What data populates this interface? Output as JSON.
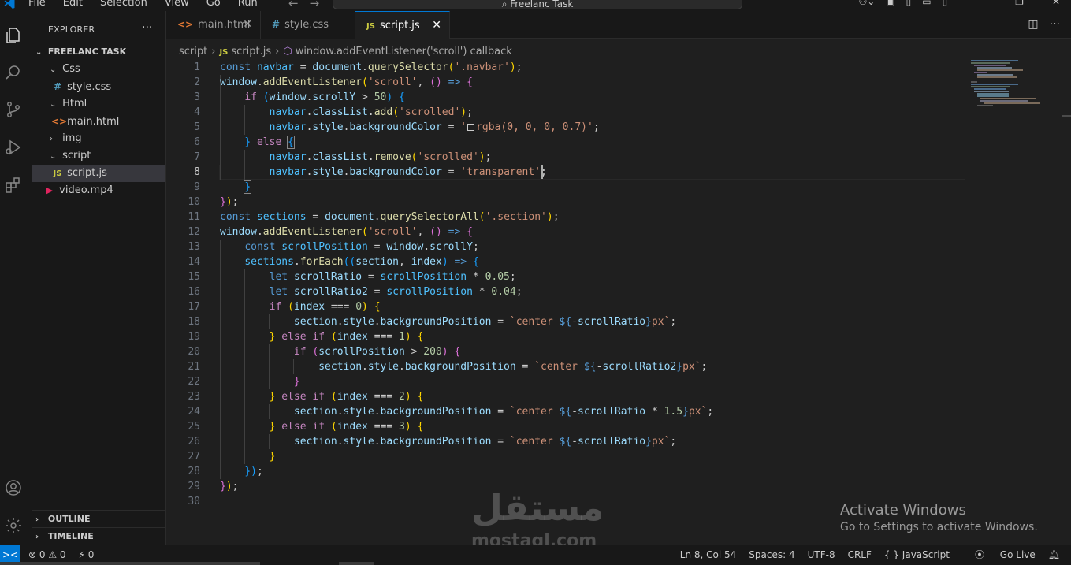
{
  "titlebar": {
    "menu": [
      "File",
      "Edit",
      "Selection",
      "View",
      "Go",
      "Run"
    ],
    "search_text": "Freelanc Task"
  },
  "sidebar": {
    "header": "EXPLORER",
    "more_label": "···",
    "root": "FREELANC TASK",
    "tree": [
      {
        "label": "Css",
        "chevron": "⌄"
      },
      {
        "label": "style.css",
        "icon": "#"
      },
      {
        "label": "Html",
        "chevron": "⌄"
      },
      {
        "label": "main.html",
        "icon": "<>"
      },
      {
        "label": "img",
        "chevron": "›"
      },
      {
        "label": "script",
        "chevron": "⌄"
      },
      {
        "label": "script.js",
        "icon": "JS"
      },
      {
        "label": "video.mp4",
        "icon": "▶"
      }
    ],
    "outline": "OUTLINE",
    "timeline": "TIMELINE"
  },
  "tabs": [
    {
      "label": "main.html",
      "icon": "<>"
    },
    {
      "label": "style.css",
      "icon": "#"
    },
    {
      "label": "script.js",
      "icon": "JS"
    }
  ],
  "breadcrumb": {
    "folder": "script",
    "file": "script.js",
    "symbol": "window.addEventListener('scroll') callback"
  },
  "editor": {
    "line_numbers": [
      "1",
      "2",
      "3",
      "4",
      "5",
      "6",
      "7",
      "8",
      "9",
      "10",
      "11",
      "12",
      "13",
      "14",
      "15",
      "16",
      "17",
      "18",
      "19",
      "20",
      "21",
      "22",
      "23",
      "24",
      "25",
      "26",
      "27",
      "28",
      "29",
      "30"
    ],
    "current_line": 8
  },
  "watermark": {
    "activate_title": "Activate Windows",
    "activate_sub": "Go to Settings to activate Windows.",
    "brand_ar": "مستقل",
    "brand_en": "mostaql.com"
  },
  "statusbar": {
    "remote_icon": "><",
    "errors": "⊗ 0 ⚠ 0",
    "ports": "⚡ 0",
    "position": "Ln 8, Col 54",
    "spaces": "Spaces: 4",
    "encoding": "UTF-8",
    "eol": "CRLF",
    "language": "{ } JavaScript",
    "golive": "Go Live"
  },
  "colors": {
    "accent": "#0078d4",
    "background": "#1f1f1f",
    "keyword": "#569cd6",
    "variable": "#9cdcfe",
    "function": "#dcdcaa",
    "string": "#ce9178",
    "number": "#b5cea8"
  }
}
